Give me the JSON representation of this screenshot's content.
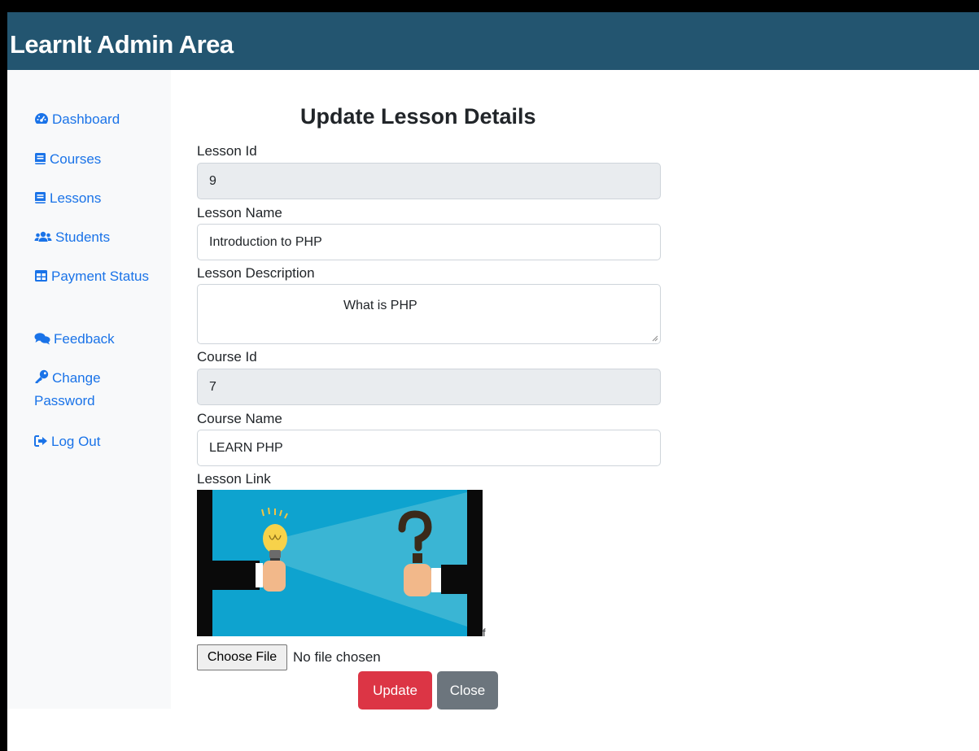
{
  "app": {
    "title": "LearnIt Admin Area"
  },
  "sidebar": {
    "items": [
      {
        "icon": "dashboard-icon",
        "label": "Dashboard"
      },
      {
        "icon": "book-icon",
        "label": "Courses"
      },
      {
        "icon": "book-icon",
        "label": "Lessons"
      },
      {
        "icon": "users-icon",
        "label": "Students"
      },
      {
        "icon": "table-icon",
        "label": "Payment Status"
      },
      {
        "icon": "comments-icon",
        "label": "Feedback"
      },
      {
        "icon": "key-icon",
        "label": "Change Password"
      },
      {
        "icon": "sign-out-icon",
        "label": "Log Out"
      }
    ]
  },
  "form": {
    "heading": "Update Lesson Details",
    "lesson_id": {
      "label": "Lesson Id",
      "value": "9"
    },
    "lesson_name": {
      "label": "Lesson Name",
      "value": "Introduction to PHP"
    },
    "lesson_description": {
      "label": "Lesson Description",
      "value": "What is PHP"
    },
    "course_id": {
      "label": "Course Id",
      "value": "7"
    },
    "course_name": {
      "label": "Course Name",
      "value": "LEARN PHP"
    },
    "lesson_link": {
      "label": "Lesson Link",
      "trailing_char": "f"
    },
    "file_input": {
      "button_label": "Choose File",
      "status": "No file chosen"
    },
    "buttons": {
      "update": "Update",
      "close": "Close"
    }
  },
  "colors": {
    "topbar": "#235570",
    "sidebar_bg": "#f8f9fa",
    "link": "#1a73e8",
    "update": "#dc3545",
    "close": "#6c757d",
    "readonly_bg": "#e9ecef"
  }
}
